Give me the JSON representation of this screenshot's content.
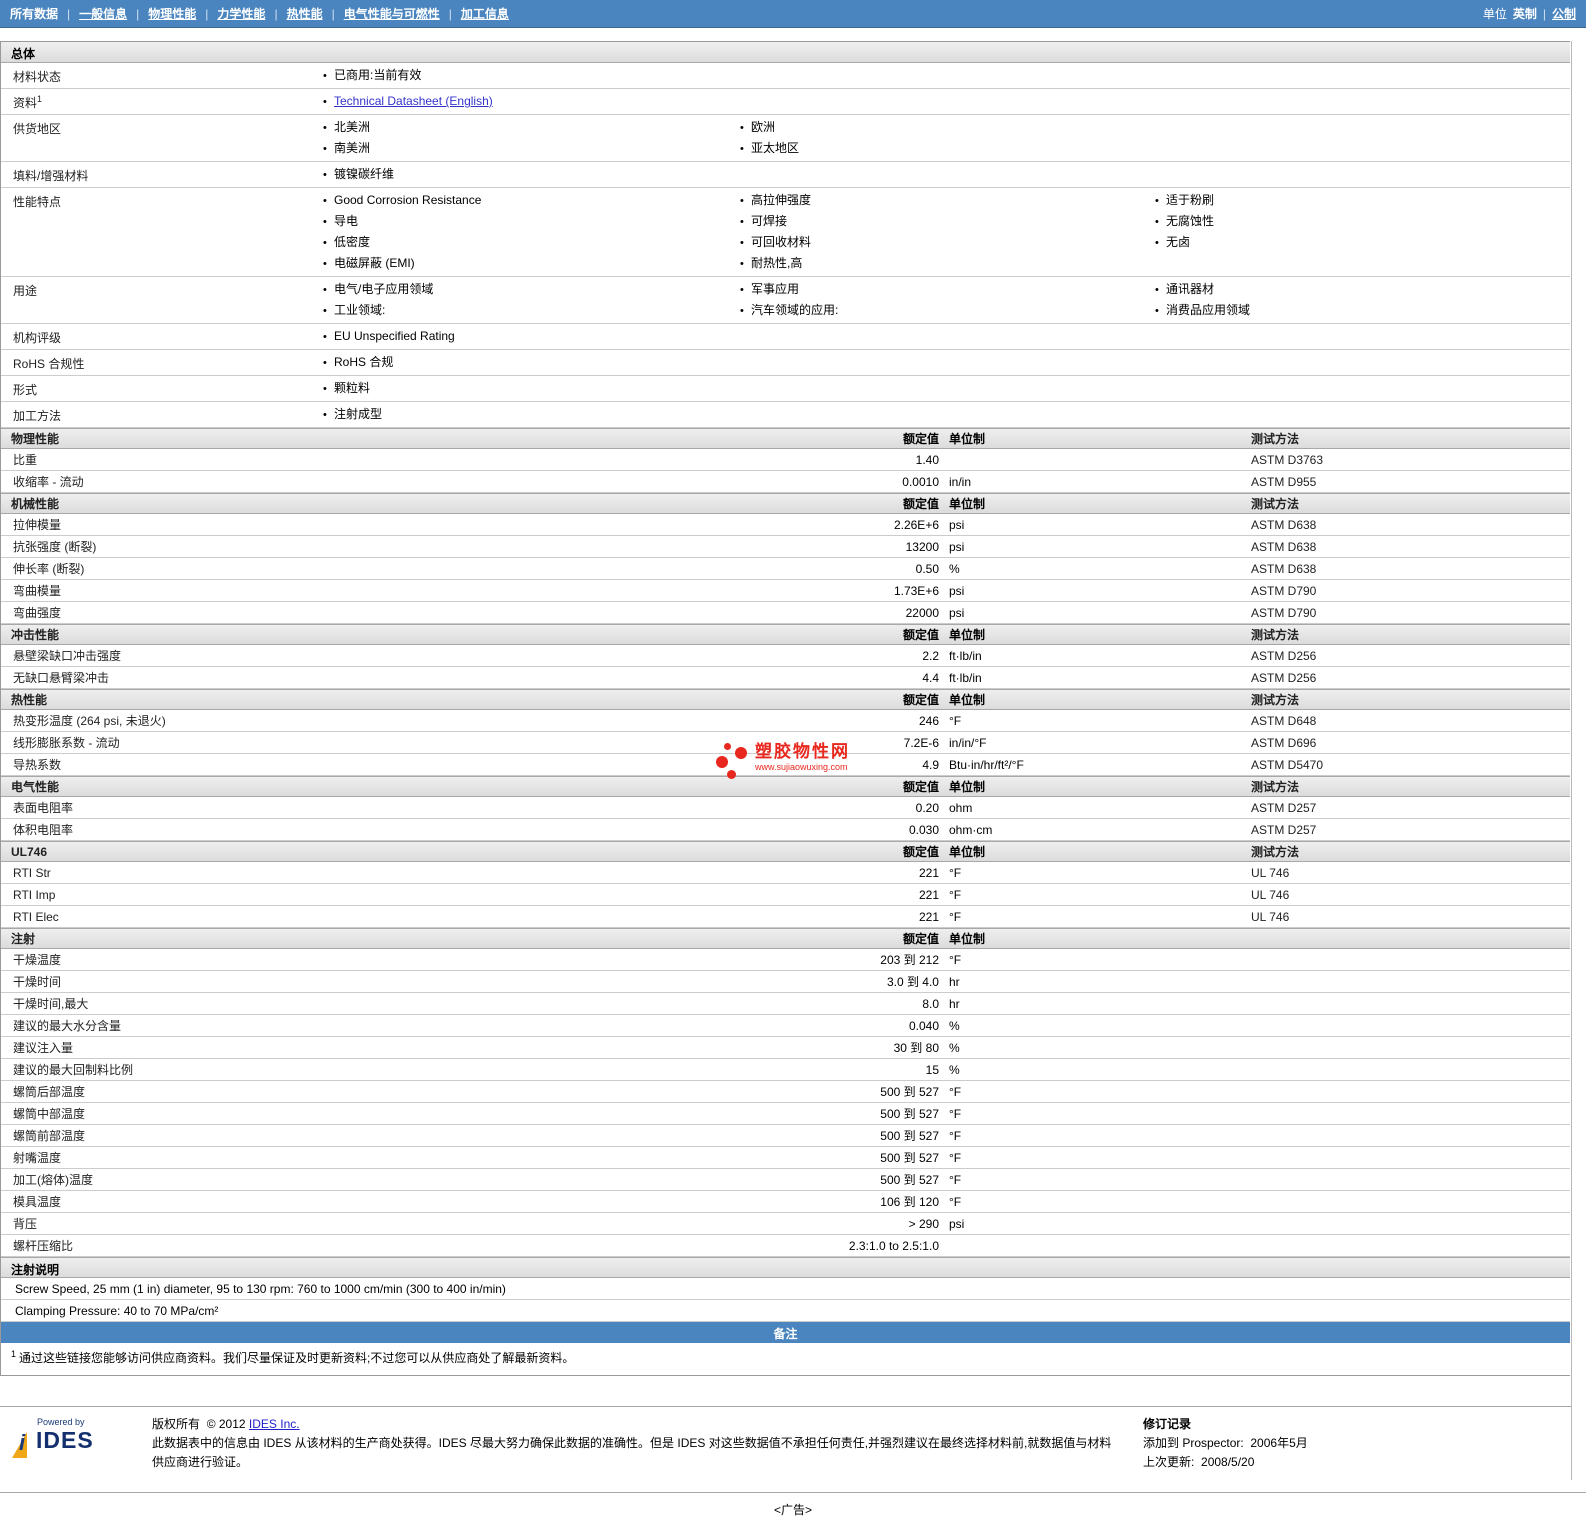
{
  "colors": {
    "accent_blue": "#4a85bf",
    "watermark_red": "#e8281e",
    "link_blue": "#3333cc"
  },
  "nav": {
    "items": [
      {
        "label": "所有数据",
        "active": true
      },
      {
        "label": "一般信息",
        "active": false
      },
      {
        "label": "物理性能",
        "active": false
      },
      {
        "label": "力学性能",
        "active": false
      },
      {
        "label": "热性能",
        "active": false
      },
      {
        "label": "电气性能与可燃性",
        "active": false
      },
      {
        "label": "加工信息",
        "active": false
      }
    ],
    "units_label": "单位",
    "unit_current": "英制",
    "unit_alt": "公制"
  },
  "general": {
    "title": "总体",
    "rows": [
      {
        "label": "材料状态",
        "sup": "",
        "columns": [
          [
            {
              "text": "已商用:当前有效",
              "link": false
            }
          ]
        ]
      },
      {
        "label": "资料",
        "sup": "1",
        "columns": [
          [
            {
              "text": "Technical Datasheet (English)",
              "link": true
            }
          ]
        ]
      },
      {
        "label": "供货地区",
        "sup": "",
        "columns": [
          [
            {
              "text": "北美洲",
              "link": false
            },
            {
              "text": "南美洲",
              "link": false
            }
          ],
          [
            {
              "text": "欧洲",
              "link": false
            },
            {
              "text": "亚太地区",
              "link": false
            }
          ]
        ]
      },
      {
        "label": "填料/增强材料",
        "sup": "",
        "columns": [
          [
            {
              "text": "镀镍碳纤维",
              "link": false
            }
          ]
        ]
      },
      {
        "label": "性能特点",
        "sup": "",
        "columns": [
          [
            {
              "text": "Good Corrosion Resistance",
              "link": false
            },
            {
              "text": "导电",
              "link": false
            },
            {
              "text": "低密度",
              "link": false
            },
            {
              "text": "电磁屏蔽 (EMI)",
              "link": false
            }
          ],
          [
            {
              "text": "高拉伸强度",
              "link": false
            },
            {
              "text": "可焊接",
              "link": false
            },
            {
              "text": "可回收材料",
              "link": false
            },
            {
              "text": "耐热性,高",
              "link": false
            }
          ],
          [
            {
              "text": "适于粉刷",
              "link": false
            },
            {
              "text": "无腐蚀性",
              "link": false
            },
            {
              "text": "无卤",
              "link": false
            }
          ]
        ]
      },
      {
        "label": "用途",
        "sup": "",
        "columns": [
          [
            {
              "text": "电气/电子应用领域",
              "link": false
            },
            {
              "text": "工业领域:",
              "link": false
            }
          ],
          [
            {
              "text": "军事应用",
              "link": false
            },
            {
              "text": "汽车领域的应用:",
              "link": false
            }
          ],
          [
            {
              "text": "通讯器材",
              "link": false
            },
            {
              "text": "消费品应用领域",
              "link": false
            }
          ]
        ]
      },
      {
        "label": "机构评级",
        "sup": "",
        "columns": [
          [
            {
              "text": "EU Unspecified Rating",
              "link": false
            }
          ]
        ]
      },
      {
        "label": "RoHS 合规性",
        "sup": "",
        "columns": [
          [
            {
              "text": "RoHS 合规",
              "link": false
            }
          ]
        ]
      },
      {
        "label": "形式",
        "sup": "",
        "columns": [
          [
            {
              "text": "颗粒料",
              "link": false
            }
          ]
        ]
      },
      {
        "label": "加工方法",
        "sup": "",
        "columns": [
          [
            {
              "text": "注射成型",
              "link": false
            }
          ]
        ]
      }
    ]
  },
  "prop_tables": [
    {
      "title": "物理性能",
      "value_header": "额定值",
      "unit_header": "单位制",
      "method_header": "测试方法",
      "show_method": true,
      "rows": [
        {
          "name": "比重",
          "value": "1.40",
          "unit": "",
          "method": "ASTM D3763"
        },
        {
          "name": "收缩率 - 流动",
          "value": "0.0010",
          "unit": "in/in",
          "method": "ASTM D955"
        }
      ]
    },
    {
      "title": "机械性能",
      "value_header": "额定值",
      "unit_header": "单位制",
      "method_header": "测试方法",
      "show_method": true,
      "rows": [
        {
          "name": "拉伸模量",
          "value": "2.26E+6",
          "unit": "psi",
          "method": "ASTM D638"
        },
        {
          "name": "抗张强度 (断裂)",
          "value": "13200",
          "unit": "psi",
          "method": "ASTM D638"
        },
        {
          "name": "伸长率 (断裂)",
          "value": "0.50",
          "unit": "%",
          "method": "ASTM D638"
        },
        {
          "name": "弯曲模量",
          "value": "1.73E+6",
          "unit": "psi",
          "method": "ASTM D790"
        },
        {
          "name": "弯曲强度",
          "value": "22000",
          "unit": "psi",
          "method": "ASTM D790"
        }
      ]
    },
    {
      "title": "冲击性能",
      "value_header": "额定值",
      "unit_header": "单位制",
      "method_header": "测试方法",
      "show_method": true,
      "rows": [
        {
          "name": "悬壁梁缺口冲击强度",
          "value": "2.2",
          "unit": "ft·lb/in",
          "method": "ASTM D256"
        },
        {
          "name": "无缺口悬臂梁冲击",
          "value": "4.4",
          "unit": "ft·lb/in",
          "method": "ASTM D256"
        }
      ]
    },
    {
      "title": "热性能",
      "value_header": "额定值",
      "unit_header": "单位制",
      "method_header": "测试方法",
      "show_method": true,
      "rows": [
        {
          "name": "热变形温度  (264 psi, 未退火)",
          "value": "246",
          "unit": "°F",
          "method": "ASTM D648"
        },
        {
          "name": "线形膨胀系数 - 流动",
          "value": "7.2E-6",
          "unit": "in/in/°F",
          "method": "ASTM D696"
        },
        {
          "name": "导热系数",
          "value": "4.9",
          "unit": "Btu·in/hr/ft²/°F",
          "method": "ASTM D5470"
        }
      ]
    },
    {
      "title": "电气性能",
      "value_header": "额定值",
      "unit_header": "单位制",
      "method_header": "测试方法",
      "show_method": true,
      "rows": [
        {
          "name": "表面电阻率",
          "value": "0.20",
          "unit": "ohm",
          "method": "ASTM D257"
        },
        {
          "name": "体积电阻率",
          "value": "0.030",
          "unit": "ohm·cm",
          "method": "ASTM D257"
        }
      ]
    },
    {
      "title": "UL746",
      "value_header": "额定值",
      "unit_header": "单位制",
      "method_header": "测试方法",
      "show_method": true,
      "rows": [
        {
          "name": "RTI Str",
          "value": "221",
          "unit": "°F",
          "method": "UL 746"
        },
        {
          "name": "RTI Imp",
          "value": "221",
          "unit": "°F",
          "method": "UL 746"
        },
        {
          "name": "RTI Elec",
          "value": "221",
          "unit": "°F",
          "method": "UL 746"
        }
      ]
    },
    {
      "title": "注射",
      "value_header": "额定值",
      "unit_header": "单位制",
      "method_header": "",
      "show_method": false,
      "rows": [
        {
          "name": "干燥温度",
          "value": "203 到  212",
          "unit": "°F",
          "method": ""
        },
        {
          "name": "干燥时间",
          "value": "3.0 到  4.0",
          "unit": "hr",
          "method": ""
        },
        {
          "name": "干燥时间,最大",
          "value": "8.0",
          "unit": "hr",
          "method": ""
        },
        {
          "name": "建议的最大水分含量",
          "value": "0.040",
          "unit": "%",
          "method": ""
        },
        {
          "name": "建议注入量",
          "value": "30 到  80",
          "unit": "%",
          "method": ""
        },
        {
          "name": "建议的最大回制料比例",
          "value": "15",
          "unit": "%",
          "method": ""
        },
        {
          "name": "螺筒后部温度",
          "value": "500 到  527",
          "unit": "°F",
          "method": ""
        },
        {
          "name": "螺筒中部温度",
          "value": "500 到  527",
          "unit": "°F",
          "method": ""
        },
        {
          "name": "螺筒前部温度",
          "value": "500 到  527",
          "unit": "°F",
          "method": ""
        },
        {
          "name": "射嘴温度",
          "value": "500 到  527",
          "unit": "°F",
          "method": ""
        },
        {
          "name": "加工(熔体)温度",
          "value": "500 到  527",
          "unit": "°F",
          "method": ""
        },
        {
          "name": "模具温度",
          "value": "106 到  120",
          "unit": "°F",
          "method": ""
        },
        {
          "name": "背压",
          "value": "> 290",
          "unit": "psi",
          "method": ""
        },
        {
          "name": "螺杆压缩比",
          "value": "2.3:1.0 to 2.5:1.0",
          "unit": "",
          "method": ""
        }
      ]
    }
  ],
  "injection_notes": {
    "title": "注射说明",
    "lines": [
      "Screw Speed, 25 mm (1 in) diameter, 95 to 130 rpm: 760 to 1000 cm/min (300 to 400 in/min)",
      "Clamping Pressure: 40 to 70 MPa/cm²"
    ]
  },
  "remarks": {
    "title": "备注",
    "footnote_sup": "1",
    "footnote_text": "通过这些链接您能够访问供应商资料。我们尽量保证及时更新资料;不过您可以从供应商处了解最新资料。"
  },
  "watermark": {
    "name": "塑胶物性网",
    "url": "www.sujiaowuxing.com"
  },
  "footer": {
    "powered_by": "Powered by",
    "logo_text": "IDES",
    "copyright_prefix": "版权所有",
    "copyright_year": "© 2012",
    "copyright_link": "IDES Inc.",
    "disclaimer": "此数据表中的信息由 IDES 从该材料的生产商处获得。IDES 尽最大努力确保此数据的准确性。但是 IDES 对这些数据值不承担任何责任,并强烈建议在最终选择材料前,就数据值与材料供应商进行验证。",
    "revision_title": "修订记录",
    "added_label": "添加到 Prospector:",
    "added_value": "2006年5月",
    "updated_label": "上次更新:",
    "updated_value": "2008/5/20"
  },
  "ad_label": "<广告>"
}
